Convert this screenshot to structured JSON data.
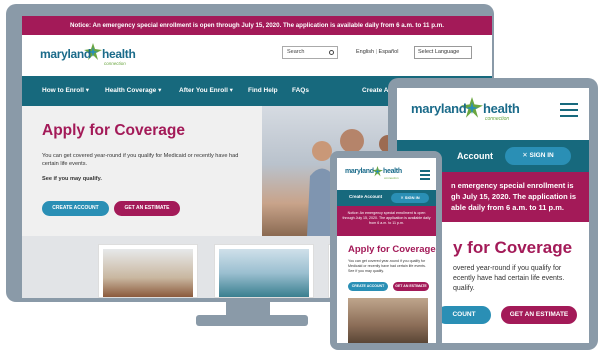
{
  "brand": {
    "name_part1": "maryland",
    "name_part2": "health",
    "name_part3": "connection",
    "colors": {
      "primary": "#17697d",
      "accent": "#a31a58",
      "button_blue": "#2a8fb5",
      "logo_green": "#6aa640"
    }
  },
  "desktop": {
    "notice": "Notice: An emergency special enrollment is open through July 15, 2020. The application is available daily from 6 a.m. to 11 p.m.",
    "search_placeholder": "Search",
    "lang_english": "English",
    "lang_espanol": "Español",
    "select_language": "Select Language",
    "nav": {
      "how_to_enroll": "How to Enroll ▾",
      "health_coverage": "Health Coverage ▾",
      "after_you_enroll": "After You Enroll ▾",
      "find_help": "Find Help",
      "faqs": "FAQs",
      "create_account": "Create A"
    },
    "hero": {
      "title": "Apply for Coverage",
      "paragraph": "You can get covered year-round if you qualify for Medicaid or recently have had certain life events.",
      "bold_link": "See if you may qualify.",
      "create_account_button": "CREATE ACCOUNT",
      "estimate_button": "GET AN ESTIMATE"
    }
  },
  "tablet": {
    "account": "Account",
    "sign_in": "SIGN IN",
    "notice": "n emergency special enrollment is gh July 15, 2020. The application is able daily from 6 a.m. to 11 p.m.",
    "title": "y for Coverage",
    "paragraph": "overed year-round if you qualify for ecently have had certain life events. qualify.",
    "create_account_button": "COUNT",
    "estimate_button": "GET AN ESTIMATE"
  },
  "phone": {
    "create_account": "Create Account",
    "sign_in": "SIGN IN",
    "notice": "Notice: An emergency special enrollment is open through July 15, 2020. The application is available daily from 6 a.m. to 11 p.m.",
    "title": "Apply for Coverage",
    "paragraph": "You can get covered year-round if you qualify for Medicaid or recently have had certain life events. See if you may qualify.",
    "create_account_button": "CREATE ACCOUNT",
    "estimate_button": "GET AN ESTIMATE"
  }
}
